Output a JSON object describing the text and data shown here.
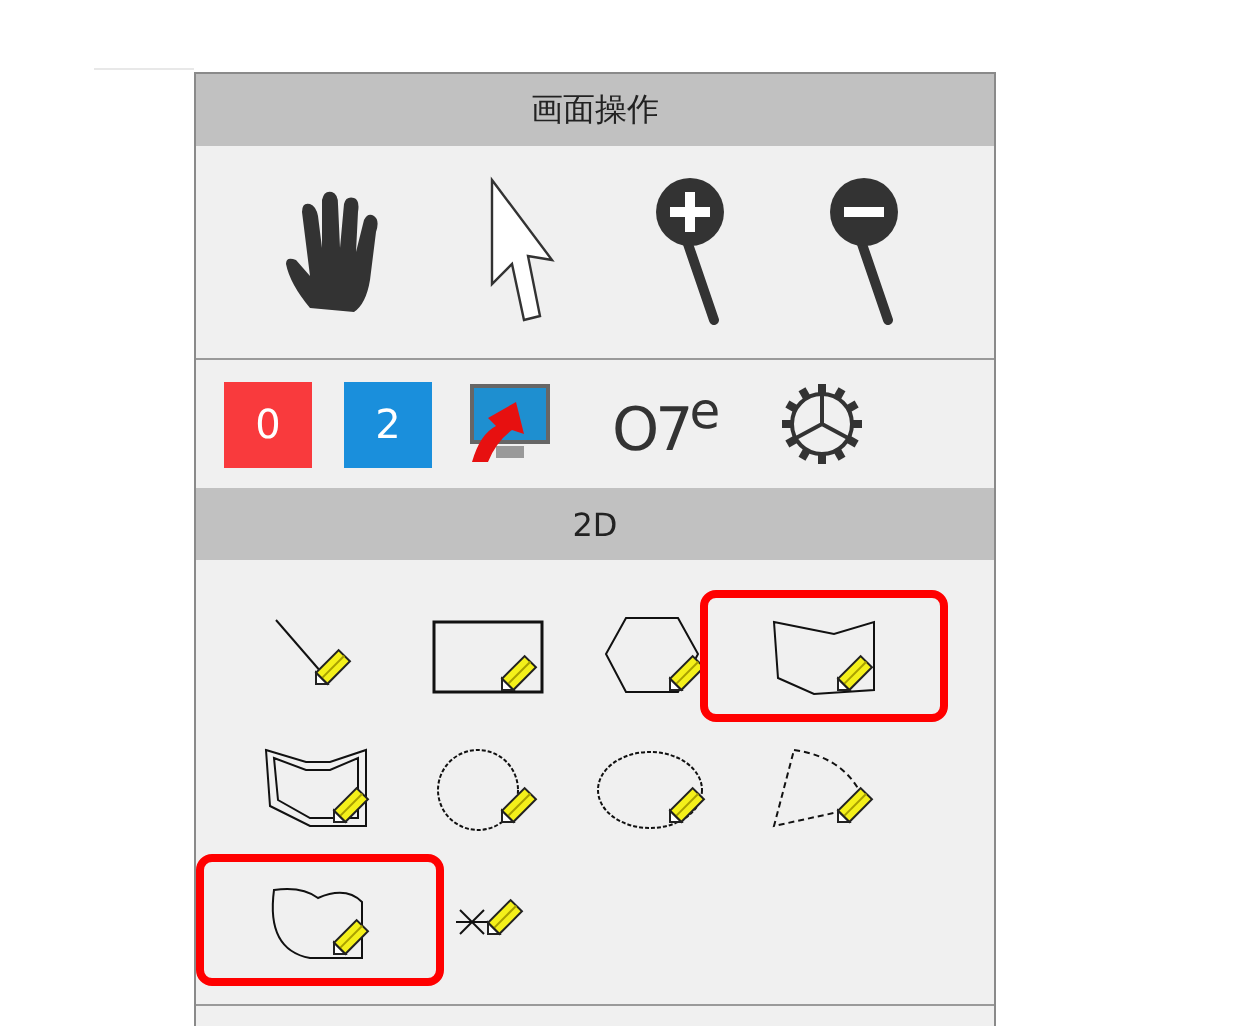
{
  "panel_title": "画面操作",
  "view_tools": [
    {
      "kind": "hand"
    },
    {
      "kind": "pointer"
    },
    {
      "kind": "zoom-in"
    },
    {
      "kind": "zoom-out"
    }
  ],
  "badges": [
    {
      "label": "0",
      "color": "#f93a3d"
    },
    {
      "label": "2",
      "color": "#1a8fdc"
    }
  ],
  "numbering_label": "O7$^{e}$",
  "section_title": "2D",
  "draw_tools": [
    {
      "kind": "line",
      "highlighted": false
    },
    {
      "kind": "rectangle",
      "highlighted": false
    },
    {
      "kind": "hexagon",
      "highlighted": false
    },
    {
      "kind": "polygon",
      "highlighted": true
    },
    {
      "kind": "double-polygon",
      "highlighted": false
    },
    {
      "kind": "circle",
      "highlighted": false
    },
    {
      "kind": "ellipse",
      "highlighted": false
    },
    {
      "kind": "arc",
      "highlighted": false
    },
    {
      "kind": "freeform",
      "highlighted": true
    },
    {
      "kind": "point",
      "highlighted": false
    }
  ]
}
